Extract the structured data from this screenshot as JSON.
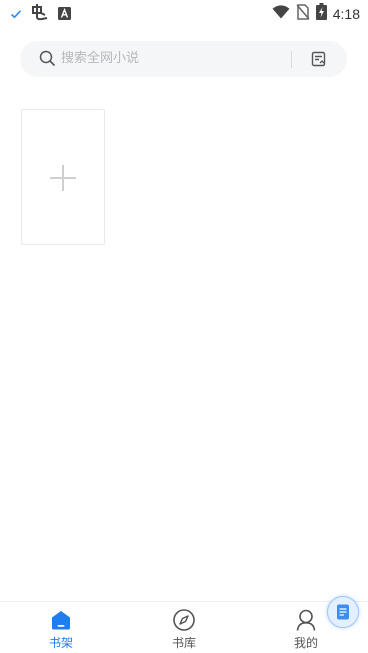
{
  "status_bar": {
    "time": "4:18",
    "left_icons": [
      "check-icon",
      "app-logo-icon",
      "a-badge-icon"
    ],
    "right_icons": [
      "wifi-icon",
      "no-sim-icon",
      "battery-charging-icon"
    ]
  },
  "search": {
    "placeholder": "搜索全网小说",
    "right_icon": "list-edit-icon"
  },
  "bookshelf": {
    "add_card_icon": "plus-icon"
  },
  "bottom_nav": {
    "items": [
      {
        "label": "书架",
        "icon": "home-icon",
        "active": true
      },
      {
        "label": "书库",
        "icon": "compass-icon",
        "active": false
      },
      {
        "label": "我的",
        "icon": "user-icon",
        "active": false
      }
    ]
  },
  "floating_button": {
    "icon": "document-icon"
  },
  "colors": {
    "accent": "#1e7ef0",
    "search_bg": "#f4f6f8",
    "placeholder": "#b5b8bc"
  }
}
